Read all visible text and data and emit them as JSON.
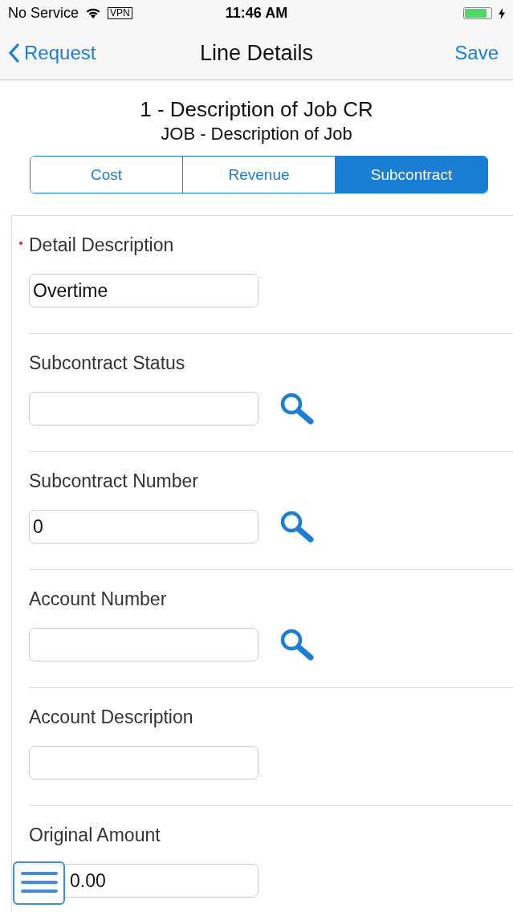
{
  "status_bar": {
    "carrier": "No Service",
    "vpn": "VPN",
    "time": "11:46 AM",
    "charging": true
  },
  "nav": {
    "back": "Request",
    "title": "Line Details",
    "action": "Save"
  },
  "header": {
    "title": "1 - Description of Job CR",
    "subtitle": "JOB - Description of Job"
  },
  "tabs": [
    {
      "label": "Cost",
      "selected": false
    },
    {
      "label": "Revenue",
      "selected": false
    },
    {
      "label": "Subcontract",
      "selected": true
    }
  ],
  "fields": [
    {
      "label": "Detail Description",
      "value": "Overtime",
      "required": true,
      "lookup": false
    },
    {
      "label": "Subcontract Status",
      "required": false,
      "lookup": true
    },
    {
      "label": "Subcontract Number",
      "value": "0",
      "required": false,
      "lookup": true
    },
    {
      "label": "Account Number",
      "required": false,
      "lookup": true
    },
    {
      "label": "Account Description",
      "required": false,
      "lookup": false
    },
    {
      "label": "Original Amount",
      "value": "0.00",
      "required": false,
      "lookup": false
    }
  ]
}
